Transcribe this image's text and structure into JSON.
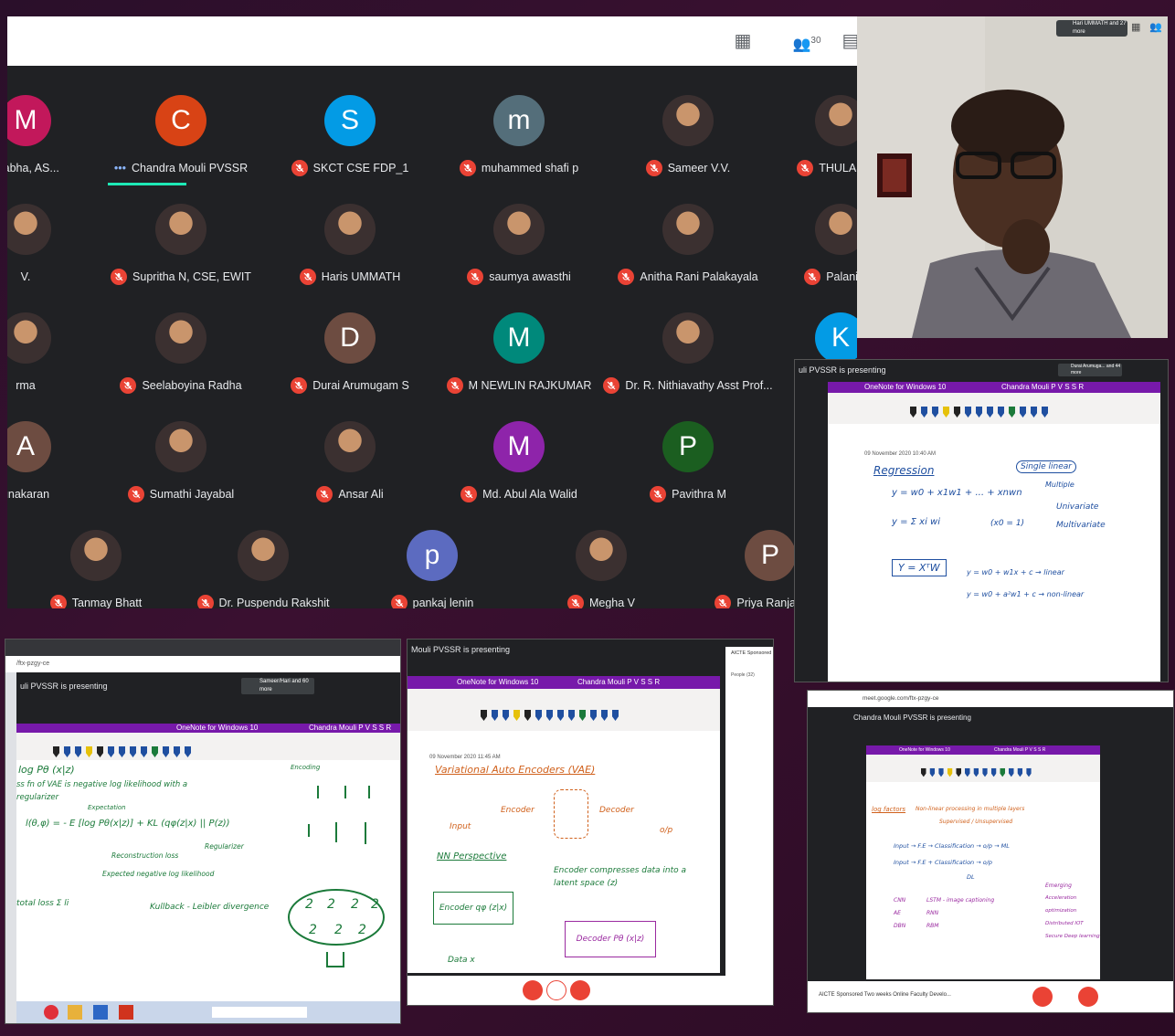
{
  "meet_top": {
    "people_count": "30"
  },
  "participants": [
    {
      "name": "Prabha, AS...",
      "initial": "M",
      "color": "#c2185b",
      "muted": false,
      "photo": false
    },
    {
      "name": "Chandra Mouli PVSSR",
      "initial": "C",
      "color": "#d84315",
      "muted": false,
      "photo": false,
      "speaking": true
    },
    {
      "name": "SKCT CSE FDP_1",
      "initial": "S",
      "color": "#039be5",
      "muted": true,
      "photo": false
    },
    {
      "name": "muhammed shafi p",
      "initial": "m",
      "color": "#546e7a",
      "muted": true,
      "photo": false
    },
    {
      "name": "Sameer V.V.",
      "initial": "",
      "color": "#3b3030",
      "muted": true,
      "photo": true
    },
    {
      "name": "THULASIMA",
      "initial": "",
      "color": "#3b3030",
      "muted": true,
      "photo": true
    },
    {
      "name": "V.",
      "initial": "",
      "color": "#3b3030",
      "muted": false,
      "photo": true
    },
    {
      "name": "Supritha N, CSE, EWIT",
      "initial": "",
      "color": "#3b3030",
      "muted": true,
      "photo": true
    },
    {
      "name": "Haris UMMATH",
      "initial": "",
      "color": "#3b3030",
      "muted": true,
      "photo": true
    },
    {
      "name": "saumya awasthi",
      "initial": "",
      "color": "#3b3030",
      "muted": true,
      "photo": true
    },
    {
      "name": "Anitha Rani Palakayala",
      "initial": "",
      "color": "#3b3030",
      "muted": true,
      "photo": true
    },
    {
      "name": "Palani Vel",
      "initial": "",
      "color": "#3b3030",
      "muted": true,
      "photo": true
    },
    {
      "name": "rma",
      "initial": "",
      "color": "#3b3030",
      "muted": false,
      "photo": true
    },
    {
      "name": "Seelaboyina Radha",
      "initial": "",
      "color": "#3b3030",
      "muted": true,
      "photo": true
    },
    {
      "name": "Durai Arumugam S",
      "initial": "D",
      "color": "#6d4c41",
      "muted": true,
      "photo": false
    },
    {
      "name": "M NEWLIN RAJKUMAR",
      "initial": "M",
      "color": "#00897b",
      "muted": true,
      "photo": false
    },
    {
      "name": "Dr. R. Nithiavathy Asst Prof...",
      "initial": "",
      "color": "#3b3030",
      "muted": true,
      "photo": true
    },
    {
      "name": "",
      "initial": "K",
      "color": "#039be5",
      "muted": true,
      "photo": false
    },
    {
      "name": "unakaran",
      "initial": "A",
      "color": "#6d4c41",
      "muted": false,
      "photo": false
    },
    {
      "name": "Sumathi Jayabal",
      "initial": "",
      "color": "#3b3030",
      "muted": true,
      "photo": true
    },
    {
      "name": "Ansar Ali",
      "initial": "",
      "color": "#3b3030",
      "muted": true,
      "photo": true
    },
    {
      "name": "Md. Abul Ala Walid",
      "initial": "M",
      "color": "#8e24aa",
      "muted": true,
      "photo": false
    },
    {
      "name": "Pavithra M",
      "initial": "P",
      "color": "#1b5e20",
      "muted": true,
      "photo": false
    },
    {
      "name": "",
      "initial": "",
      "color": "#3b3030",
      "muted": true,
      "photo": false
    },
    {
      "name": "Tanmay Bhatt",
      "initial": "",
      "color": "#3b3030",
      "muted": true,
      "photo": true
    },
    {
      "name": "Dr. Puspendu Rakshit",
      "initial": "",
      "color": "#3b3030",
      "muted": true,
      "photo": true
    },
    {
      "name": "pankaj lenin",
      "initial": "p",
      "color": "#5c6bc0",
      "muted": true,
      "photo": false
    },
    {
      "name": "Megha V",
      "initial": "",
      "color": "#3b3030",
      "muted": true,
      "photo": true
    },
    {
      "name": "Priya Ranjan Das",
      "initial": "P",
      "color": "#6d4c41",
      "muted": true,
      "photo": false
    }
  ],
  "video_panel": {
    "badge": "Hari UMMATH and 27 more"
  },
  "win_regression": {
    "presenting": "uli PVSSR is presenting",
    "badge": "Durai Arumuga... and 44 more",
    "app_title": "OneNote for Windows 10",
    "user": "Chandra Mouli P V S S R",
    "date": "09 November 2020   10:40 AM",
    "notes": [
      "Regression",
      "Single linear",
      "Multiple",
      "Univariate",
      "Multivariate",
      "y = w0 + x1w1 + ... + xnwn",
      "y = Σ xi wi",
      "(x0 = 1)",
      "Y = XᵀW",
      "y = w0 + w1x + c → linear",
      "y = w0 + a²w1 + c → non-linear"
    ]
  },
  "win_log": {
    "url": "/ftx-pzgy-ce",
    "presenting": "uli PVSSR is presenting",
    "badge": "Sameer/Hari and 60 more",
    "app_title": "OneNote for Windows 10",
    "user": "Chandra Mouli P V S S R",
    "notes": [
      "log Pθ (x|z)",
      "ss fn of VAE is negative log likelihood with a",
      "regularizer",
      "Expectation",
      "l(θ,φ) = - E [log Pθ(x|z)] + KL (qφ(z|x) || P(z))",
      "Reconstruction loss",
      "Expected negative log likelihood",
      "Regularizer",
      "Kullback - Leibler divergence",
      "total loss  Σ li",
      "Encoding"
    ]
  },
  "win_vae": {
    "presenting": "Mouli PVSSR is presenting",
    "app_title": "OneNote for Windows 10",
    "user": "Chandra Mouli P V S S R",
    "date": "09 November 2020      11:45 AM",
    "notes": [
      "Variational Auto Encoders (VAE)",
      "Input",
      "Encoder",
      "Decoder",
      "o/p",
      "NN Perspective",
      "Encoder  qφ (z|x)",
      "Decoder  Pθ (x|z)",
      "Data   x",
      "Encoder compresses data into a latent space (z)"
    ],
    "side_label": "AICTE Sponsored",
    "people": "People (32)"
  },
  "win_dl": {
    "url": "meet.google.com/ftx-pzgy-ce",
    "presenting": "Chandra Mouli PVSSR is presenting",
    "app_title": "OneNote for Windows 10",
    "user": "Chandra Mouli P V S S R",
    "bottom": "AICTE Sponsored Two weeks Online Faculty Develo...",
    "notes": [
      "log factors",
      "Non-linear processing in multiple layers",
      "Supervised / Unsupervised",
      "Input → F.E → Classification → o/p → ML",
      "Input → F.E + Classification → o/p",
      "DL",
      "CNN",
      "RNN",
      "RBM",
      "DBN",
      "AE",
      "LSTM - image captioning",
      "Emerging",
      "Acceleration",
      "optimization",
      "Distributed IOT",
      "Secure Deep learning"
    ]
  }
}
